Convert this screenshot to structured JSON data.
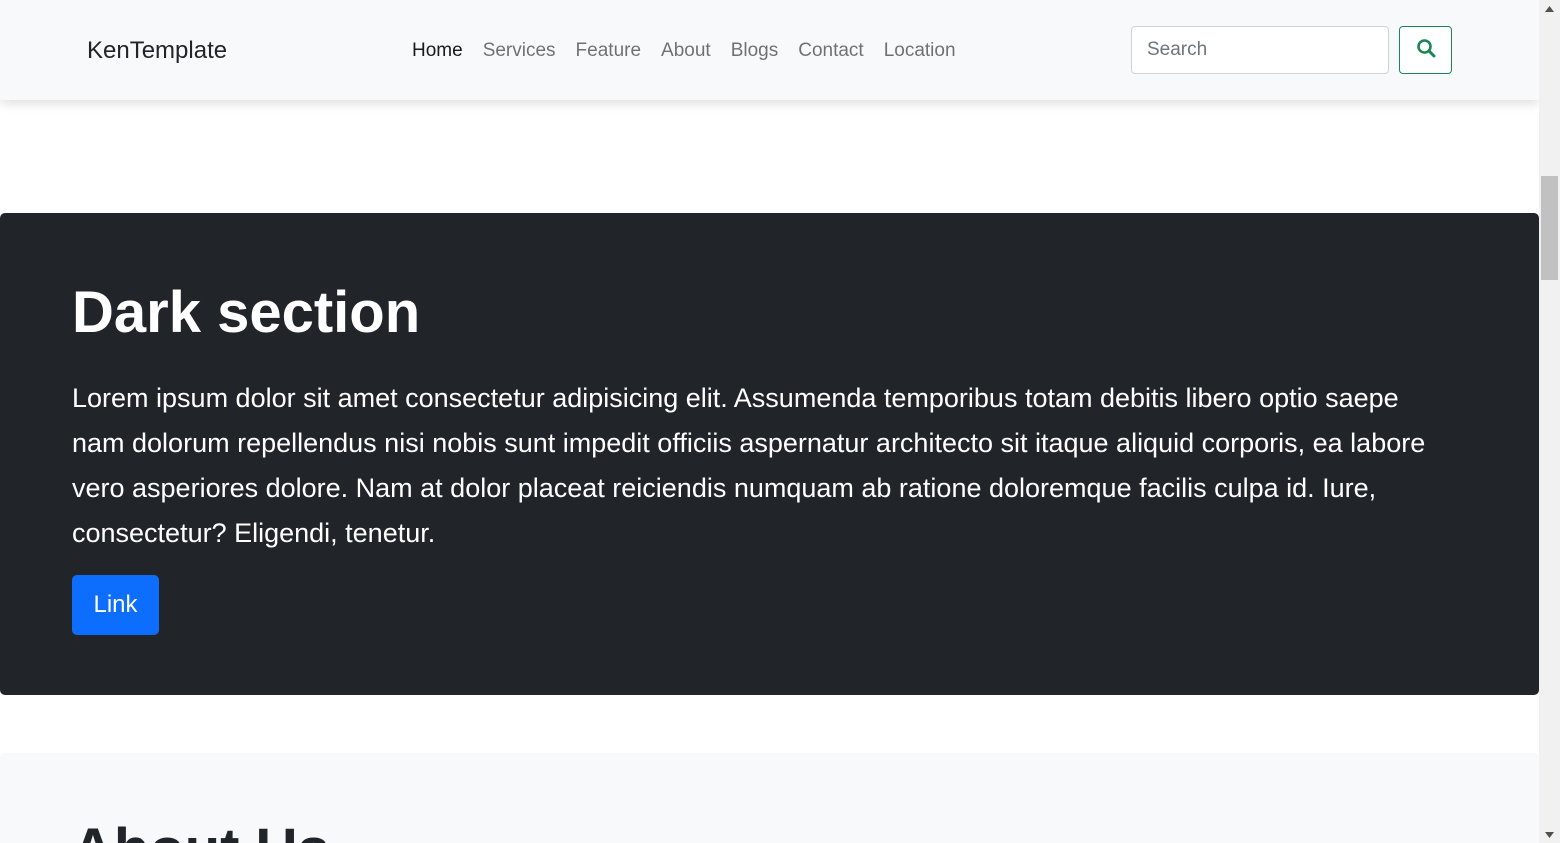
{
  "navbar": {
    "brand": "KenTemplate",
    "links": [
      {
        "label": "Home"
      },
      {
        "label": "Services"
      },
      {
        "label": "Feature"
      },
      {
        "label": "About"
      },
      {
        "label": "Blogs"
      },
      {
        "label": "Contact"
      },
      {
        "label": "Location"
      }
    ],
    "active_link": "Home",
    "search": {
      "placeholder": "Search",
      "value": ""
    },
    "search_button_icon": "search-icon"
  },
  "dark_section": {
    "title": "Dark section",
    "text": "Lorem ipsum dolor sit amet consectetur adipisicing elit. Assumenda temporibus totam debitis libero optio saepe nam dolorum repellendus nisi nobis sunt impedit officiis aspernatur architecto sit itaque aliquid corporis, ea labore vero asperiores dolore. Nam at dolor placeat reiciendis numquam ab ratione doloremque facilis culpa id. Iure, consectetur? Eligendi, tenetur.",
    "button_label": "Link"
  },
  "light_section": {
    "title": "About Us"
  },
  "colors": {
    "navbar_bg": "#f8f9fa",
    "dark_bg": "#212529",
    "primary": "#0d6efd",
    "success": "#198754"
  }
}
